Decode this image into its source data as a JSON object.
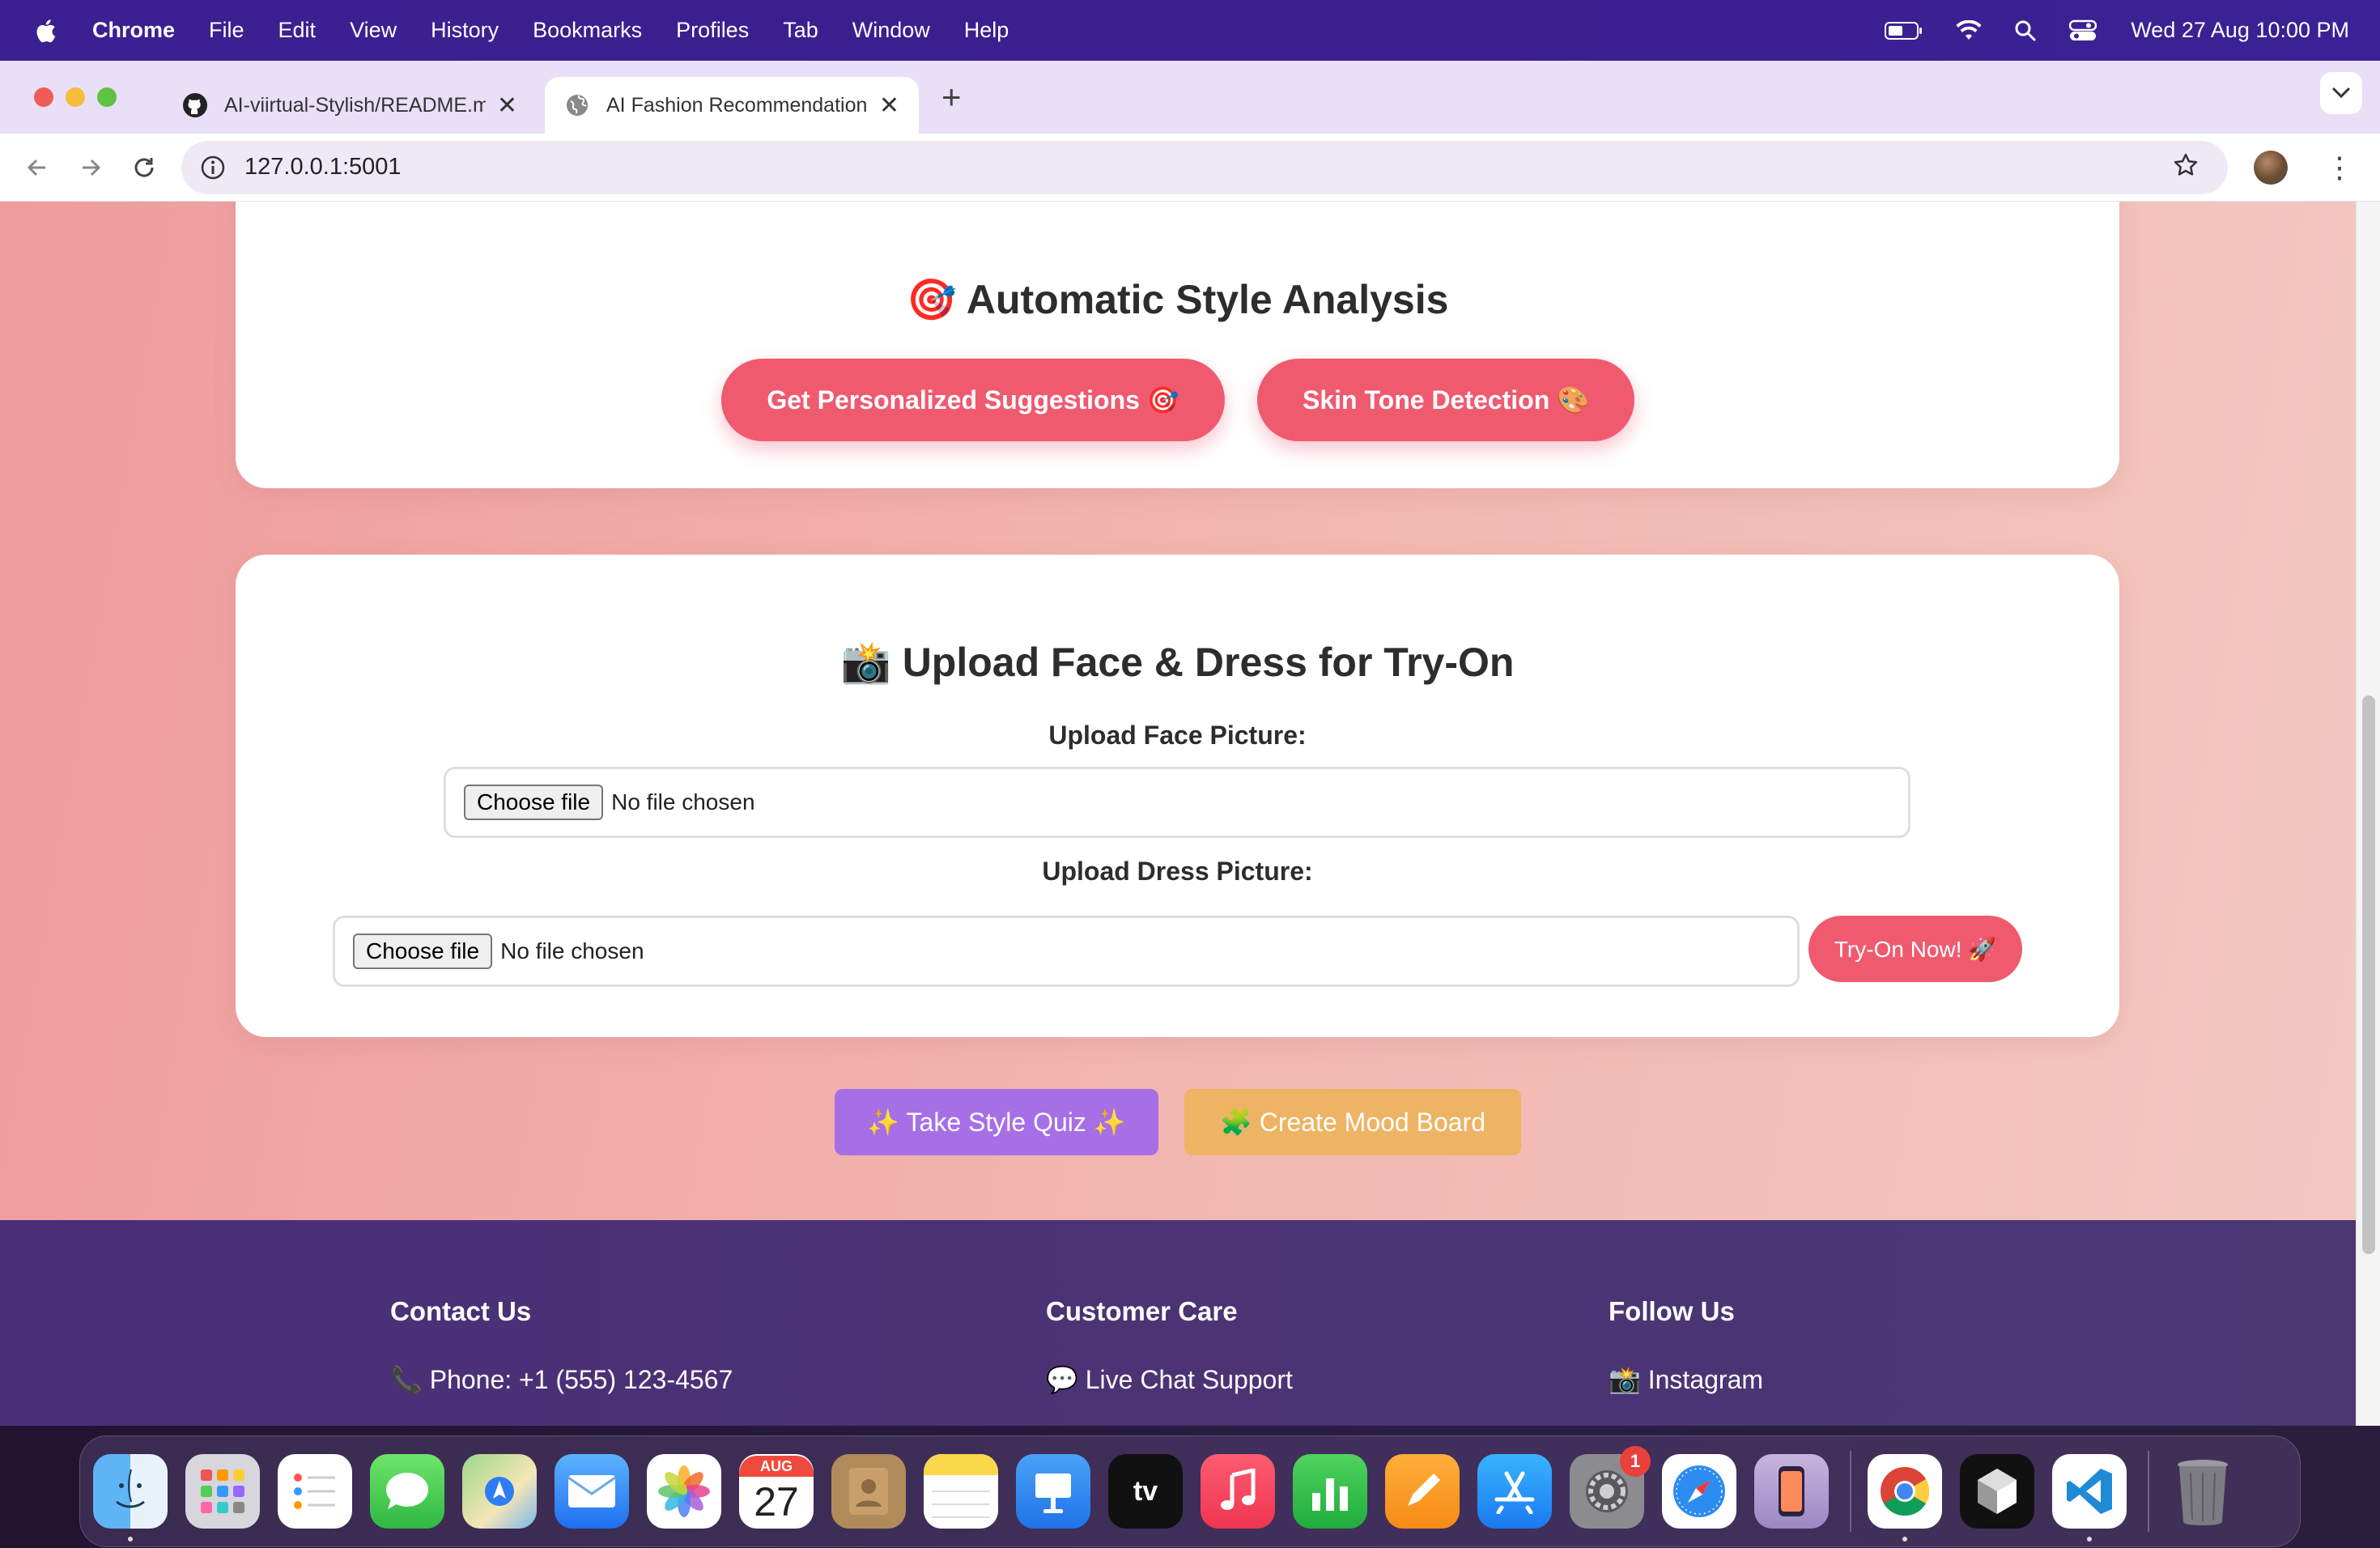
{
  "menubar": {
    "app_name": "Chrome",
    "items": [
      "File",
      "Edit",
      "View",
      "History",
      "Bookmarks",
      "Profiles",
      "Tab",
      "Window",
      "Help"
    ],
    "clock": "Wed 27 Aug  10:00 PM",
    "status_icons": [
      "battery-icon",
      "wifi-icon",
      "spotlight-search-icon",
      "control-center-icon"
    ]
  },
  "browser": {
    "tabs": [
      {
        "title": "AI-viirtual-Stylish/README.m",
        "icon": "github-icon",
        "active": false
      },
      {
        "title": "AI Fashion Recommendation",
        "icon": "globe-icon",
        "active": true
      }
    ],
    "new_tab": "+",
    "url": "127.0.0.1:5001"
  },
  "page": {
    "style_analysis": {
      "emoji": "🎯",
      "title": "Automatic Style Analysis",
      "suggest_button": "Get Personalized Suggestions 🎯",
      "skin_button": "Skin Tone Detection 🎨"
    },
    "tryon": {
      "emoji": "📸",
      "title": "Upload Face & Dress for Try-On",
      "face_label": "Upload Face Picture:",
      "dress_label": "Upload Dress Picture:",
      "choose_file": "Choose file",
      "no_file": "No file chosen",
      "tryon_button": "Try-On Now! 🚀"
    },
    "quiz_button": "✨ Take Style Quiz ✨",
    "mood_button": "🧩 Create Mood Board"
  },
  "footer": {
    "contact": {
      "heading": "Contact Us",
      "line": "📞 Phone: +1 (555) 123-4567"
    },
    "care": {
      "heading": "Customer Care",
      "line": "💬 Live Chat Support"
    },
    "follow": {
      "heading": "Follow Us",
      "line": "📸 Instagram"
    }
  },
  "dock": {
    "calendar_month": "AUG",
    "calendar_day": "27",
    "tv_label": "tv",
    "settings_badge": "1",
    "apps": [
      "Finder",
      "Launchpad",
      "Reminders",
      "Messages",
      "Maps",
      "Mail",
      "Photos",
      "Calendar",
      "Contacts",
      "Notes",
      "Keynote",
      "TV",
      "Music",
      "Numbers",
      "Pages",
      "App Store",
      "System Settings",
      "Safari",
      "iPhone Mirroring",
      "Chrome",
      "Unity",
      "Visual Studio Code",
      "Trash"
    ]
  }
}
